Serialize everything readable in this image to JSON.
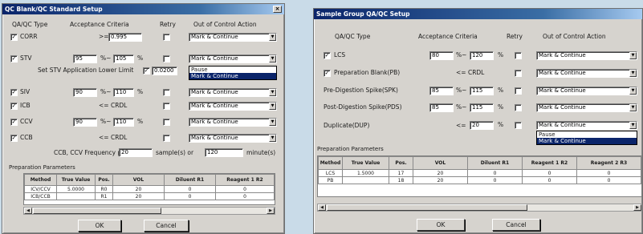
{
  "left": {
    "title": "QC Blank/QC Standard Setup",
    "close": "×",
    "headers": {
      "type": "QA/QC Type",
      "criteria": "Acceptance Criteria",
      "retry": "Retry",
      "action": "Out of Control Action"
    },
    "rows": [
      {
        "checked": "✓",
        "label": "CORR",
        "pre": "",
        "low": "",
        "mid": ">=",
        "high": "0.995",
        "suffix": "",
        "action": "Mark & Continue"
      },
      {
        "checked": "✓",
        "label": "STV",
        "pre": "",
        "low": "95",
        "mid": "%~",
        "high": "105",
        "suffix": "%",
        "action": "Mark & Continue"
      },
      {
        "checked": "✓",
        "label": "SIV",
        "pre": "",
        "low": "90",
        "mid": "%~",
        "high": "110",
        "suffix": "%",
        "action": "Mark & Continue"
      },
      {
        "checked": "✓",
        "label": "ICB",
        "pre": "",
        "low": "",
        "mid": "<= CRDL",
        "high": "",
        "suffix": "",
        "action": "Mark & Continue"
      },
      {
        "checked": "✓",
        "label": "CCV",
        "pre": "",
        "low": "90",
        "mid": "%~",
        "high": "110",
        "suffix": "%",
        "action": "Mark & Continue"
      },
      {
        "checked": "✓",
        "label": "CCB",
        "pre": "",
        "low": "",
        "mid": "<= CRDL",
        "high": "",
        "suffix": "",
        "action": "Mark & Continue"
      }
    ],
    "stv_limit": {
      "label": "Set STV Application Lower Limit",
      "checked": "✓",
      "value": "0.0200"
    },
    "dropdown": [
      "Pause",
      "Mark & Continue"
    ],
    "frequency": {
      "label": "CCB, CCV Frequency per",
      "samples": "20",
      "samples_unit": "sample(s) or",
      "minutes": "120",
      "minutes_unit": "minute(s)"
    },
    "prep_title": "Preparation Parameters",
    "table": {
      "columns": [
        "Method",
        "True Value",
        "Pos.",
        "VOL",
        "Diluent R1",
        "Reagent 1 R2"
      ],
      "rows": [
        [
          "ICV/CCV",
          "5.0000",
          "R0",
          "20",
          "0",
          "0"
        ],
        [
          "ICB/CCB",
          "",
          "R1",
          "20",
          "0",
          "0"
        ]
      ]
    },
    "ok": "OK",
    "cancel": "Cancel"
  },
  "right": {
    "title": "Sample Group QA/QC Setup",
    "headers": {
      "type": "QA/QC Type",
      "criteria": "Acceptance Criteria",
      "retry": "Retry",
      "action": "Out of Control Action"
    },
    "rows": [
      {
        "checked": "✓",
        "label": "LCS",
        "low": "80",
        "mid": "%~",
        "high": "120",
        "suffix": "%",
        "action": "Mark & Continue"
      },
      {
        "checked": "✓",
        "label": "Preparation Blank(PB)",
        "low": "",
        "mid": "<= CRDL",
        "high": "",
        "suffix": "",
        "action": "Mark & Continue"
      },
      {
        "checked": "",
        "label": "Pre-Digestion Spike(SPK)",
        "low": "85",
        "mid": "%~",
        "high": "115",
        "suffix": "%",
        "action": "Mark & Continue"
      },
      {
        "checked": "",
        "label": "Post-Digestion Spike(PDS)",
        "low": "85",
        "mid": "%~",
        "high": "115",
        "suffix": "%",
        "action": "Mark & Continue"
      },
      {
        "checked": "",
        "label": "Duplicate(DUP)",
        "low": "",
        "mid": "<=",
        "high": "20",
        "suffix": "%",
        "action": "Mark & Continue"
      }
    ],
    "dropdown": [
      "Pause",
      "Mark & Continue"
    ],
    "prep_title": "Preparation Parameters",
    "table": {
      "columns": [
        "Method",
        "True Value",
        "Pos.",
        "VOL",
        "Diluent R1",
        "Reagent 1 R2",
        "Reagent 2 R3"
      ],
      "rows": [
        [
          "LCS",
          "1.5000",
          "17",
          "20",
          "0",
          "0",
          "0"
        ],
        [
          "PB",
          "",
          "18",
          "20",
          "0",
          "0",
          "0"
        ]
      ]
    },
    "ok": "OK",
    "cancel": "Cancel"
  }
}
